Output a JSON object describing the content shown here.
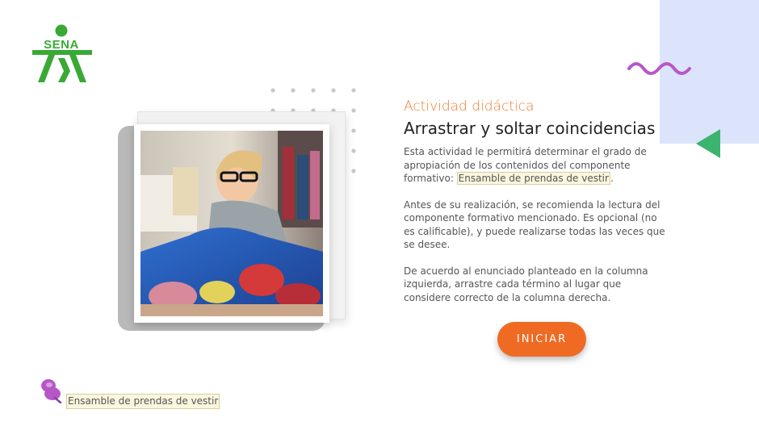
{
  "brand": {
    "logo_text": "SENA",
    "logo_color": "#39a935"
  },
  "colors": {
    "accent": "#ef6b24",
    "subtitle": "#ef7a2d",
    "panel": "#dbe4fb",
    "wave": "#b657c8",
    "triangle": "#3cb46e"
  },
  "activity": {
    "subtitle": "Actividad didáctica",
    "title": "Arrastrar y soltar coincidencias",
    "p1_text": "Esta actividad le permitirá determinar el grado de apropiación de los contenidos del componente formativo: ",
    "p1_highlight": "Ensamble de prendas de vestir",
    "p1_end": ".",
    "p2": "Antes de su realización, se recomienda la lectura del componente formativo mencionado.  Es opcional (no es calificable), y puede realizarse todas las veces que se desee.",
    "p3": "De acuerdo al enunciado planteado en la columna izquierda, arrastre cada término al lugar que considere correcto de la columna derecha."
  },
  "buttons": {
    "start_label": "INICIAR"
  },
  "footer": {
    "label": "Ensamble de prendas de vestir",
    "icon": "pushpin-icon"
  },
  "image": {
    "subject": "seamstress-at-sewing-machine"
  }
}
